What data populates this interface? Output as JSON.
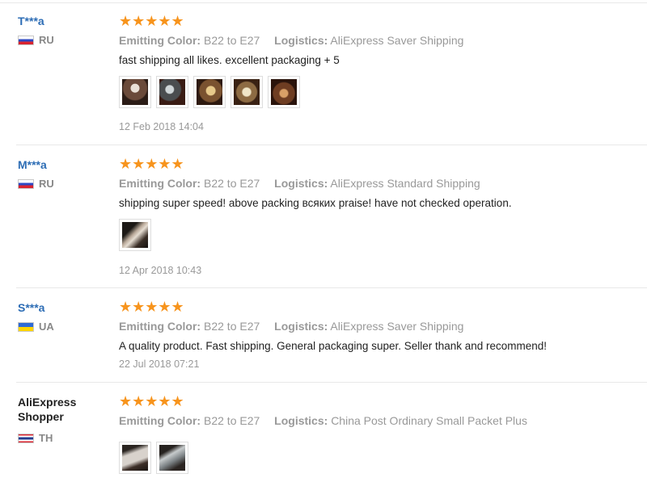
{
  "reviews": [
    {
      "user": "T***a",
      "country": "RU",
      "stars": "★★★★★",
      "color_label": "Emitting Color:",
      "color_value": "B22 to E27",
      "logistics_label": "Logistics:",
      "logistics_value": "AliExpress Saver Shipping",
      "text": "fast shipping all likes. excellent packaging + 5",
      "date": "12 Feb 2018 14:04"
    },
    {
      "user": "M***a",
      "country": "RU",
      "stars": "★★★★★",
      "color_label": "Emitting Color:",
      "color_value": "B22 to E27",
      "logistics_label": "Logistics:",
      "logistics_value": "AliExpress Standard Shipping",
      "text": "shipping super speed! above packing всяких praise! have not checked operation.",
      "date": "12 Apr 2018 10:43"
    },
    {
      "user": "S***a",
      "country": "UA",
      "stars": "★★★★★",
      "color_label": "Emitting Color:",
      "color_value": "B22 to E27",
      "logistics_label": "Logistics:",
      "logistics_value": "AliExpress Saver Shipping",
      "text": "A quality product. Fast shipping. General packaging super. Seller thank and recommend!",
      "date": "22 Jul 2018 07:21"
    },
    {
      "user_line1": "AliExpress",
      "user_line2": "Shopper",
      "country": "TH",
      "stars": "★★★★★",
      "color_label": "Emitting Color:",
      "color_value": "B22 to E27",
      "logistics_label": "Logistics:",
      "logistics_value": "China Post Ordinary Small Packet Plus"
    }
  ],
  "colors": {
    "star": "#f7941d",
    "username": "#2d6db5",
    "meta": "#999999"
  },
  "icons": {
    "rating": "star-icon",
    "country": "flag-icon"
  }
}
